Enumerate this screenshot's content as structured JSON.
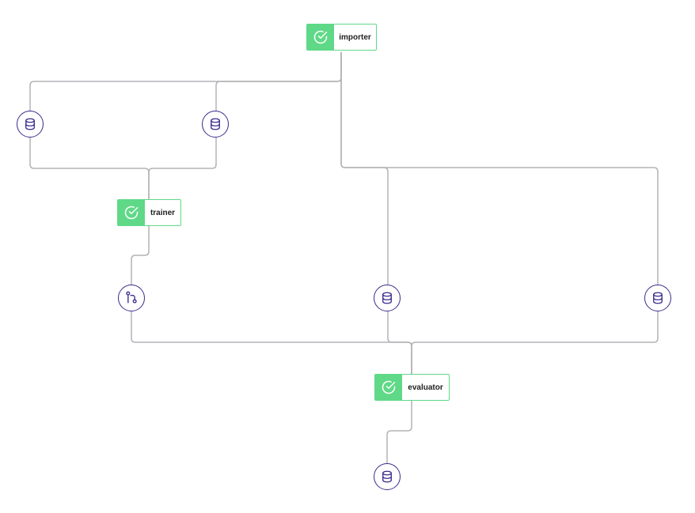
{
  "colors": {
    "step_success": "#5fd987",
    "artifact_outline": "#3b2a8c",
    "edge": "#b4b4b8"
  },
  "steps": [
    {
      "id": "importer",
      "label": "importer",
      "status": "success",
      "icon": "check-circle-icon"
    },
    {
      "id": "trainer",
      "label": "trainer",
      "status": "success",
      "icon": "check-circle-icon"
    },
    {
      "id": "evaluator",
      "label": "evaluator",
      "status": "success",
      "icon": "check-circle-icon"
    }
  ],
  "artifacts": [
    {
      "id": "importer-out-1",
      "type": "data",
      "icon": "database-icon"
    },
    {
      "id": "importer-out-2",
      "type": "data",
      "icon": "database-icon"
    },
    {
      "id": "trainer-out-model",
      "type": "model",
      "icon": "git-branch-icon"
    },
    {
      "id": "importer-out-3",
      "type": "data",
      "icon": "database-icon"
    },
    {
      "id": "importer-out-4",
      "type": "data",
      "icon": "database-icon"
    },
    {
      "id": "evaluator-out",
      "type": "data",
      "icon": "database-icon"
    }
  ],
  "edges": [
    {
      "from": "importer",
      "to": "importer-out-1"
    },
    {
      "from": "importer",
      "to": "importer-out-2"
    },
    {
      "from": "importer",
      "to": "importer-out-3"
    },
    {
      "from": "importer",
      "to": "importer-out-4"
    },
    {
      "from": "importer-out-1",
      "to": "trainer"
    },
    {
      "from": "importer-out-2",
      "to": "trainer"
    },
    {
      "from": "trainer",
      "to": "trainer-out-model"
    },
    {
      "from": "trainer-out-model",
      "to": "evaluator"
    },
    {
      "from": "importer-out-3",
      "to": "evaluator"
    },
    {
      "from": "importer-out-4",
      "to": "evaluator"
    },
    {
      "from": "evaluator",
      "to": "evaluator-out"
    }
  ]
}
